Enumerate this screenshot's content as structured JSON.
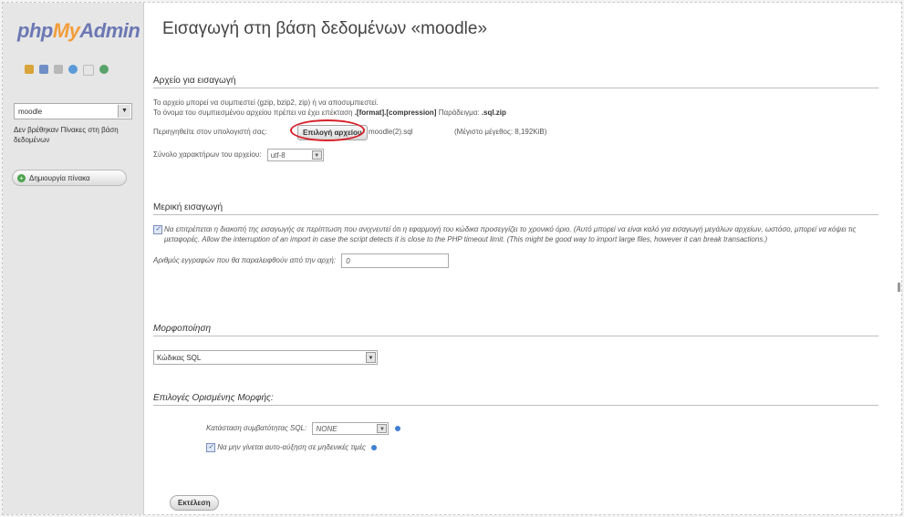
{
  "sidebar": {
    "logo": {
      "php": "php",
      "my": "My",
      "admin": "Admin"
    },
    "icons": [
      "home-icon",
      "stats-icon",
      "sql-icon",
      "info-icon",
      "docs-icon",
      "reload-icon"
    ],
    "db_select": "moodle",
    "no_tables": "Δεν βρέθηκαν Πίνακες στη βάση δεδομένων",
    "create_table": "Δημιουργία πίνακα"
  },
  "main": {
    "title": "Εισαγωγή στη βάση δεδομένων «moodle»",
    "file_section": {
      "heading": "Αρχείο για εισαγωγή",
      "line1": "Το αρχείο μπορεί να συμπιεστεί (gzip, bzip2, zip) ή να αποσυμπιεστεί.",
      "line2_prefix": "Το όνομα του συμπιεσμένου αρχείου πρέπει να έχει επέκταση",
      "line2_format": ".[format].[compression]",
      "line2_example_label": "Παράδειγμα:",
      "line2_example": ".sql.zip",
      "browse_label": "Περιηγηθείτε στον υπολογιστή σας:",
      "browse_button": "Επιλογή αρχείου",
      "chosen_file": "moodle(2).sql",
      "max_size": "(Μέγιστο μέγεθος: 8,192KiB)",
      "charset_label": "Σύνολο χαρακτήρων του αρχείου:",
      "charset_value": "utf-8"
    },
    "partial_section": {
      "heading": "Μερική εισαγωγή",
      "allow_text": "Να επιτρέπεται η διακοπή της εισαγωγής σε περίπτωση που ανιχνευτεί ότι η εφαρμογή του κώδικα προσεγγίζει το χρονικό όριο. (Αυτό μπορεί να είναι καλό για εισαγωγή μεγάλων αρχείων, ωστόσο, μπορεί να κόψει τις μεταφορές. Allow the interruption of an import in case the script detects it is close to the PHP timeout limit. (This might be good way to import large files, however it can break transactions.)",
      "skip_label": "Αριθμός εγγραφών που θα παραλειφθούν από την αρχή:",
      "skip_value": "0"
    },
    "format_section": {
      "heading": "Μορφοποίηση",
      "format_value": "Κώδικας SQL"
    },
    "options_section": {
      "heading": "Επιλογές Ορισμένης Μορφής:",
      "compat_label": "Κατάσταση συμβατότητας SQL:",
      "compat_value": "NONE",
      "auto_inc_label": "Να μην γίνεται αυτο-αύξηση σε μηδενικές τιμές"
    },
    "go_button": "Εκτέλεση"
  },
  "colors": {
    "logo_blue": "#6c78b3",
    "logo_orange": "#f29d3a",
    "highlight_red": "#d6202a"
  }
}
